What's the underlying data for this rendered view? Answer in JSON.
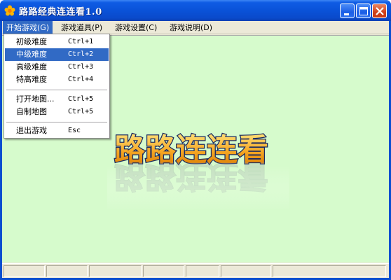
{
  "window": {
    "title": "路路经典连连看1.0",
    "icon": "app-flower-icon",
    "controls": [
      "minimize-icon",
      "maximize-icon",
      "close-icon"
    ]
  },
  "menubar": {
    "items": [
      {
        "label": "开始游戏(G)",
        "active": true
      },
      {
        "label": "游戏道具(P)",
        "active": false
      },
      {
        "label": "游戏设置(C)",
        "active": false
      },
      {
        "label": "游戏说明(D)",
        "active": false
      }
    ]
  },
  "dropdown": {
    "items": [
      {
        "label": "初级难度",
        "shortcut": "Ctrl+1",
        "highlighted": false
      },
      {
        "label": "中级难度",
        "shortcut": "Ctrl+2",
        "highlighted": true
      },
      {
        "label": "高级难度",
        "shortcut": "Ctrl+3",
        "highlighted": false
      },
      {
        "label": "特高难度",
        "shortcut": "Ctrl+4",
        "highlighted": false
      },
      {
        "label": "打开地图...",
        "shortcut": "Ctrl+5",
        "highlighted": false
      },
      {
        "label": "自制地图",
        "shortcut": "Ctrl+5",
        "highlighted": false
      },
      {
        "label": "退出游戏",
        "shortcut": "Esc",
        "highlighted": false
      }
    ]
  },
  "canvas": {
    "logo_text": "路路连连看",
    "background_color": "#d6fbcc"
  },
  "colors": {
    "title_bar": "#0a52d8",
    "menu_highlight": "#316ac5",
    "logo_orange": "#f5a623",
    "logo_outline": "#1a2a60"
  }
}
